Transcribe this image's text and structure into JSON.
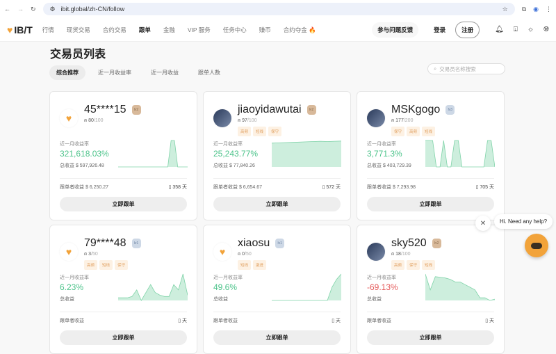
{
  "browser": {
    "url": "ibit.global/zh-CN/follow"
  },
  "nav": {
    "logo": "IB/T",
    "items": [
      "行情",
      "现货交易",
      "合约交易",
      "跟单",
      "金融",
      "VIP 服务",
      "任务中心",
      "赚币",
      "合约夺金 🔥"
    ],
    "active": 3,
    "feedback": "参与问题反馈",
    "login": "登录",
    "register": "注册"
  },
  "page": {
    "title": "交易员列表",
    "tabs": [
      "综合推荐",
      "近一月收益率",
      "近一月收益",
      "跟单人数"
    ],
    "search_placeholder": "交易员名称搜索"
  },
  "labels": {
    "roi": "近一月收益率",
    "total": "总收益",
    "follower_profit": "跟单者收益",
    "follow": "立即跟单",
    "days_unit": "天"
  },
  "colors": {
    "green": "#4cc38a",
    "red": "#e55a5a",
    "accent": "#f2a33a"
  },
  "traders": [
    {
      "name": "45****15",
      "level": "lv2",
      "followers": "80",
      "max": "/100",
      "tags": [],
      "roi": "321,618.03%",
      "total": "$ 597,926.48",
      "fp": "$ 6,250.27",
      "days": "358",
      "spark": [
        0,
        0,
        0,
        0,
        0,
        0,
        0,
        0,
        0,
        0,
        0,
        0,
        0,
        0,
        0,
        0,
        1,
        1,
        0,
        0,
        0,
        0
      ]
    },
    {
      "name": "jiaoyidawutai",
      "level": "lv2",
      "followers": "97",
      "max": "/100",
      "tags": [
        "高频",
        "短线",
        "保守"
      ],
      "roi": "25,243.77%",
      "total": "$ 77,840.26",
      "fp": "$ 6,654.67",
      "days": "572",
      "spark": [
        0.9,
        0.91,
        0.92,
        0.93,
        0.94,
        0.95,
        0.96,
        0.97,
        0.96,
        0.97,
        0.98
      ]
    },
    {
      "name": "MSKgogo",
      "level": "lv3",
      "followers": "177",
      "max": "/200",
      "tags": [
        "保守",
        "高频",
        "短线"
      ],
      "roi": "3,771.3%",
      "total": "$ 403,729.39",
      "fp": "$ 7,293.98",
      "days": "705",
      "spark": [
        1,
        1,
        1,
        0,
        0,
        1,
        0,
        0,
        1,
        1,
        0,
        0,
        0,
        0,
        0,
        0,
        0,
        1,
        1,
        0
      ]
    },
    {
      "name": "79****48",
      "level": "lv1",
      "followers": "3",
      "max": "/50",
      "tags": [
        "高频",
        "短线",
        "保守"
      ],
      "roi": "6.23%",
      "total": "",
      "fp": "",
      "days": "",
      "spark": [
        0.1,
        0.1,
        0.1,
        0.15,
        0.4,
        0,
        0.3,
        0.6,
        0.3,
        0.2,
        0.15,
        0.15,
        0.6,
        0.4,
        1,
        0.2
      ]
    },
    {
      "name": "xiaosu",
      "level": "lv1",
      "followers": "0",
      "max": "/50",
      "tags": [
        "短线",
        "激进"
      ],
      "roi": "49.6%",
      "total": "",
      "fp": "",
      "days": "",
      "spark": [
        0,
        0,
        0,
        0,
        0,
        0,
        0,
        0,
        0,
        0,
        0,
        0,
        0,
        0.5,
        0.8,
        1
      ]
    },
    {
      "name": "sky520",
      "level": "lv2",
      "followers": "18",
      "max": "/100",
      "tags": [
        "高频",
        "保守",
        "短线"
      ],
      "roi": "-69.13%",
      "total": "",
      "fp": "",
      "days": "",
      "spark": [
        1,
        0.4,
        0.9,
        0.88,
        0.85,
        0.8,
        0.7,
        0.7,
        0.6,
        0.5,
        0.4,
        0.1,
        0.1,
        0,
        0.05
      ]
    }
  ],
  "chat": {
    "message": "Hi. Need any help?"
  }
}
